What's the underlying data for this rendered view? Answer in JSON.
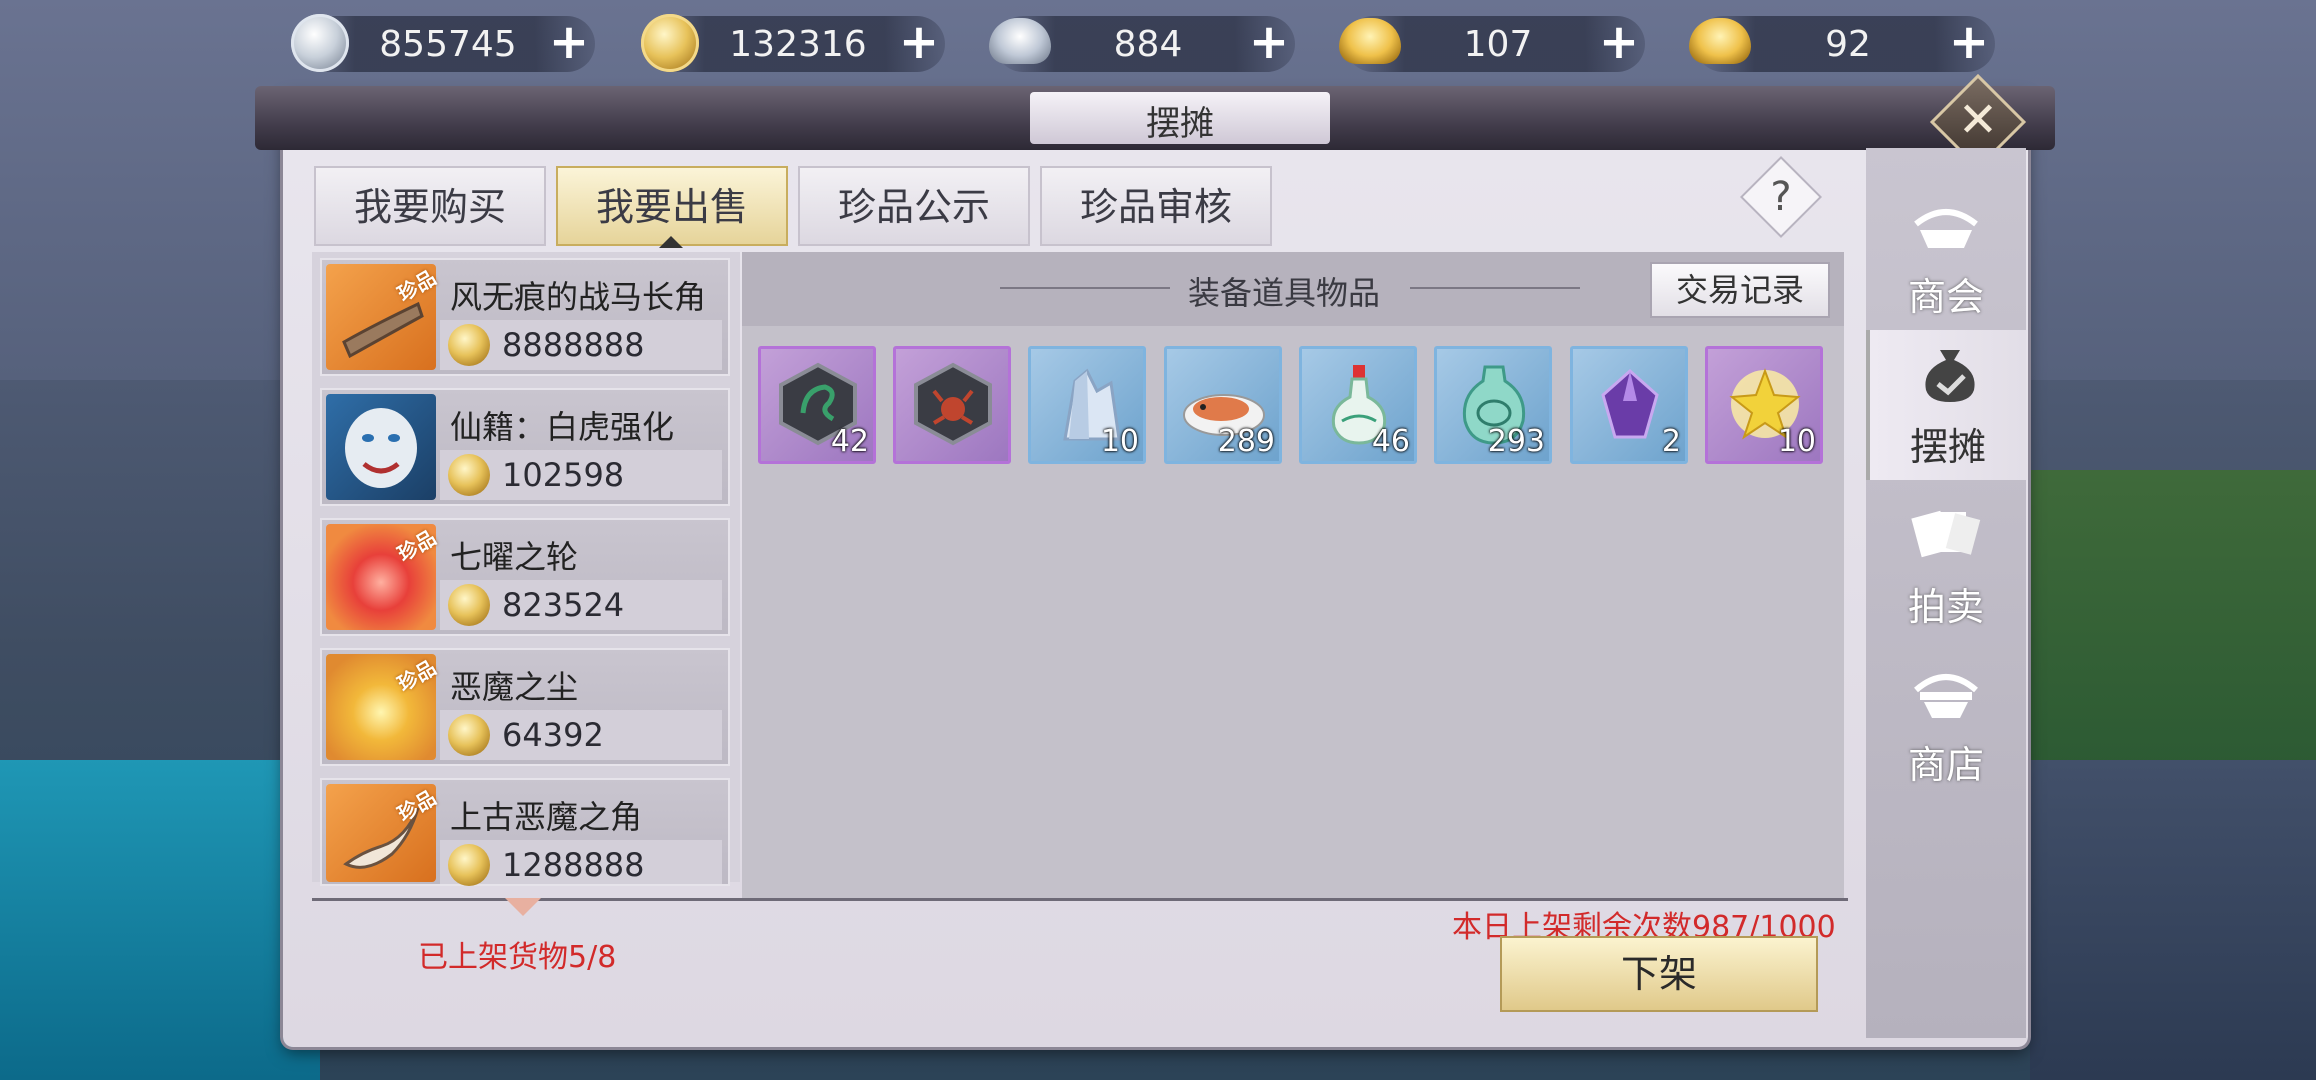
{
  "currencies": [
    {
      "name": "silver-coin",
      "value": "855745"
    },
    {
      "name": "gold-coin",
      "value": "132316"
    },
    {
      "name": "silver-ingot",
      "value": "884"
    },
    {
      "name": "gold-ingot-locked",
      "value": "107"
    },
    {
      "name": "gold-ingot",
      "value": "92"
    }
  ],
  "window": {
    "title": "摆摊"
  },
  "tabs": [
    "我要购买",
    "我要出售",
    "珍品公示",
    "珍品审核"
  ],
  "listings": [
    {
      "name": "风无痕的战马长角",
      "price": "8888888",
      "rare": "珍品"
    },
    {
      "name": "仙籍：白虎强化",
      "price": "102598",
      "rare": ""
    },
    {
      "name": "七曜之轮",
      "price": "823524",
      "rare": "珍品"
    },
    {
      "name": "恶魔之尘",
      "price": "64392",
      "rare": "珍品"
    },
    {
      "name": "上古恶魔之角",
      "price": "1288888",
      "rare": "珍品"
    }
  ],
  "listed_goods": "已上架货物5/8",
  "inventory": {
    "title": "装备道具物品",
    "record_button": "交易记录",
    "items": [
      {
        "icon": "dragon-badge-icon",
        "count": "42",
        "rarity": "purple"
      },
      {
        "icon": "crab-badge-icon",
        "count": "",
        "rarity": "purple"
      },
      {
        "icon": "crystal-icon",
        "count": "10",
        "rarity": "blue"
      },
      {
        "icon": "fish-dish-icon",
        "count": "289",
        "rarity": "blue"
      },
      {
        "icon": "porcelain-bottle-icon",
        "count": "46",
        "rarity": "blue"
      },
      {
        "icon": "jade-vase-icon",
        "count": "293",
        "rarity": "blue"
      },
      {
        "icon": "purple-gem-icon",
        "count": "2",
        "rarity": "blue"
      },
      {
        "icon": "gold-star-icon",
        "count": "10",
        "rarity": "purple"
      }
    ]
  },
  "daily_quota": "本日上架剩余次数987/1000",
  "unlist_button": "下架",
  "side_nav": [
    "商会",
    "摆摊",
    "拍卖",
    "商店"
  ]
}
